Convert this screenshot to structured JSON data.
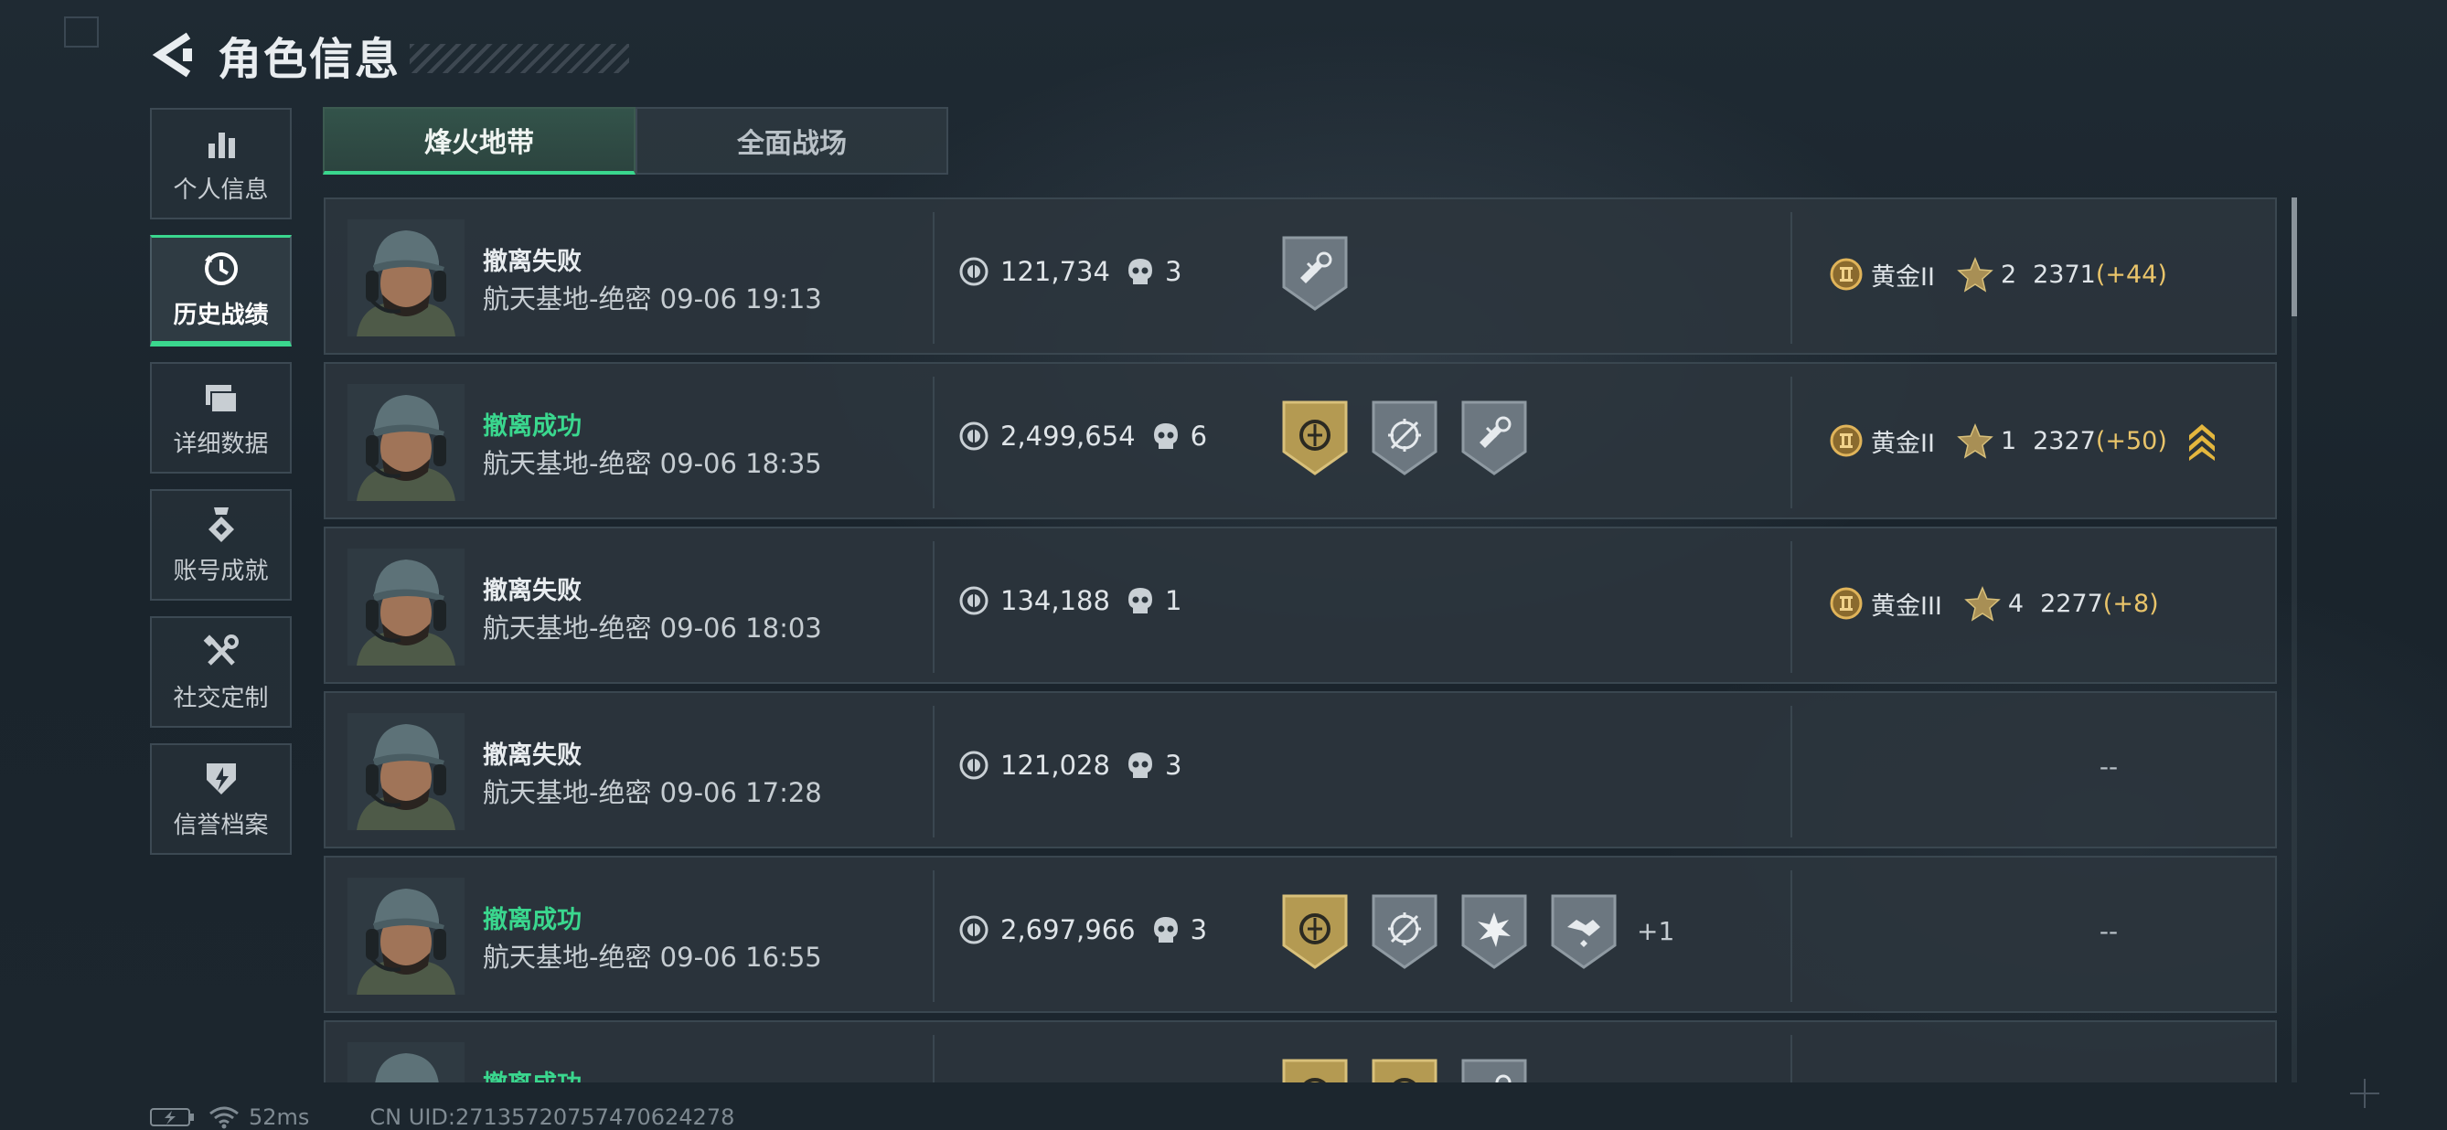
{
  "header": {
    "title": "角色信息"
  },
  "sidebar": {
    "items": [
      {
        "label": "个人信息",
        "icon": "bar-chart-icon",
        "active": false
      },
      {
        "label": "历史战绩",
        "icon": "clock-history-icon",
        "active": true
      },
      {
        "label": "详细数据",
        "icon": "folder-icon",
        "active": false
      },
      {
        "label": "账号成就",
        "icon": "medal-icon",
        "active": false
      },
      {
        "label": "社交定制",
        "icon": "tools-icon",
        "active": false
      },
      {
        "label": "信誉档案",
        "icon": "shield-icon",
        "active": false
      }
    ]
  },
  "tabs": [
    {
      "label": "烽火地带",
      "active": true
    },
    {
      "label": "全面战场",
      "active": false
    }
  ],
  "records": [
    {
      "result": "撤离失败",
      "success": false,
      "map_time": "航天基地-绝密 09-06 19:13",
      "value": "121,734",
      "kills": "3",
      "badges": [
        "gear-badge-icon"
      ],
      "extra": "",
      "rank": "黄金II",
      "rank_icon": "II",
      "stars": "2",
      "score": "2371",
      "delta": "(+44)",
      "promo": false
    },
    {
      "result": "撤离成功",
      "success": true,
      "map_time": "航天基地-绝密 09-06 18:35",
      "value": "2,499,654",
      "kills": "6",
      "badges": [
        "gold-coin-badge-icon",
        "target-badge-icon",
        "gear-badge-icon"
      ],
      "extra": "",
      "rank": "黄金II",
      "rank_icon": "II",
      "stars": "1",
      "score": "2327",
      "delta": "(+50)",
      "promo": true
    },
    {
      "result": "撤离失败",
      "success": false,
      "map_time": "航天基地-绝密 09-06 18:03",
      "value": "134,188",
      "kills": "1",
      "badges": [],
      "extra": "",
      "rank": "黄金III",
      "rank_icon": "III",
      "stars": "4",
      "score": "2277",
      "delta": "(+8)",
      "promo": false
    },
    {
      "result": "撤离失败",
      "success": false,
      "map_time": "航天基地-绝密 09-06 17:28",
      "value": "121,028",
      "kills": "3",
      "badges": [],
      "extra": "",
      "rank": "",
      "dash": "--"
    },
    {
      "result": "撤离成功",
      "success": true,
      "map_time": "航天基地-绝密 09-06 16:55",
      "value": "2,697,966",
      "kills": "3",
      "badges": [
        "gold-coin-badge-icon",
        "target-badge-icon",
        "explosion-badge-icon",
        "handshake-badge-icon"
      ],
      "extra": "+1",
      "rank": "",
      "dash": "--"
    },
    {
      "result": "撤离成功",
      "success": true,
      "map_time": "",
      "value": "",
      "kills": "",
      "badges": [
        "gold-coin-badge-icon",
        "gold-coin-badge-icon",
        "gear-badge-icon"
      ],
      "extra": "",
      "rank": "",
      "dash": ""
    }
  ],
  "footer": {
    "ping": "52ms",
    "uid": "CN UID:27135720757470624278"
  },
  "colors": {
    "accent": "#3ad78e",
    "delta": "#e9c46a",
    "success": "#3ad78e"
  }
}
